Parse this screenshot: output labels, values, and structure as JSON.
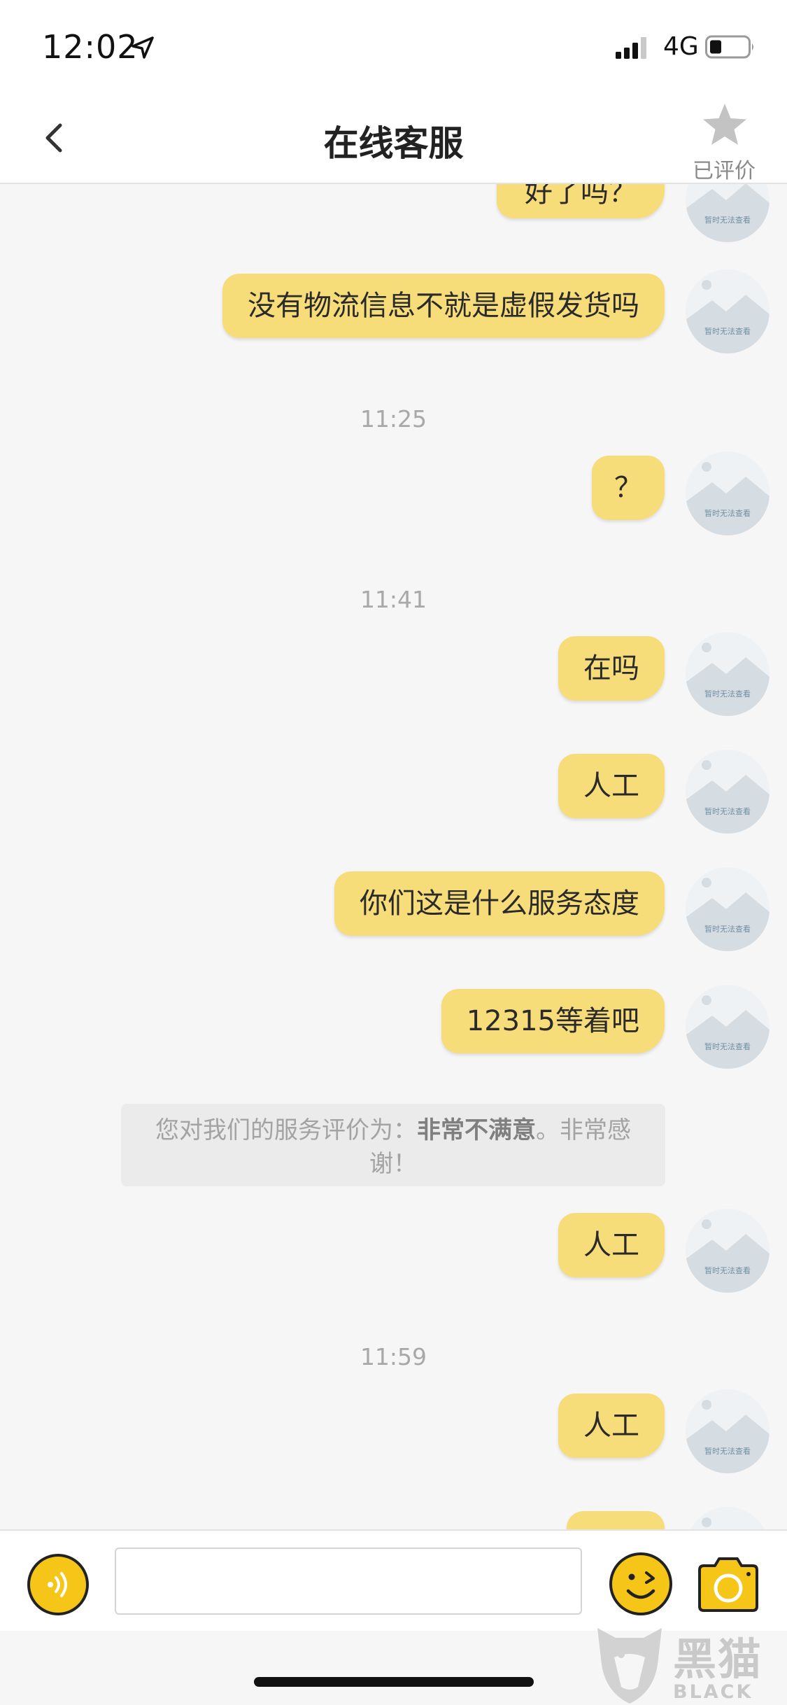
{
  "status_bar": {
    "time": "12:02",
    "network": "4G",
    "icons": [
      "location-arrow-icon",
      "signal-bars-icon",
      "battery-icon"
    ]
  },
  "nav": {
    "back_icon": "chevron-left-icon",
    "title": "在线客服",
    "rate_icon": "star-icon",
    "rate_label": "已评价"
  },
  "chat": {
    "avatar_placeholder": "暂时无法查看",
    "partial_top_message": "好了吗？",
    "messages": [
      {
        "type": "outgoing",
        "text": "没有物流信息不就是虚假发货吗"
      },
      {
        "type": "timestamp",
        "text": "11:25"
      },
      {
        "type": "outgoing",
        "text": "？"
      },
      {
        "type": "timestamp",
        "text": "11:41"
      },
      {
        "type": "outgoing",
        "text": "在吗"
      },
      {
        "type": "outgoing",
        "text": "人工"
      },
      {
        "type": "outgoing",
        "text": "你们这是什么服务态度"
      },
      {
        "type": "outgoing",
        "text": "12315等着吧"
      },
      {
        "type": "system",
        "prefix": "您对我们的服务评价为：",
        "rating": "非常不满意",
        "suffix": "。非常感谢！"
      },
      {
        "type": "outgoing",
        "text": "人工"
      },
      {
        "type": "timestamp",
        "text": "11:59"
      },
      {
        "type": "outgoing",
        "text": "人工"
      }
    ]
  },
  "input_bar": {
    "voice_icon": "voice-icon",
    "input_value": "",
    "input_placeholder": "",
    "emoji_icon": "emoji-icon",
    "camera_icon": "camera-icon"
  },
  "watermark": {
    "cn": "黑猫",
    "en": "BLACK CAT"
  },
  "colors": {
    "bubble": "#f7dc7a",
    "accent_yellow": "#f5c518",
    "background": "#f6f6f6",
    "timestamp": "#a8a8a8"
  }
}
